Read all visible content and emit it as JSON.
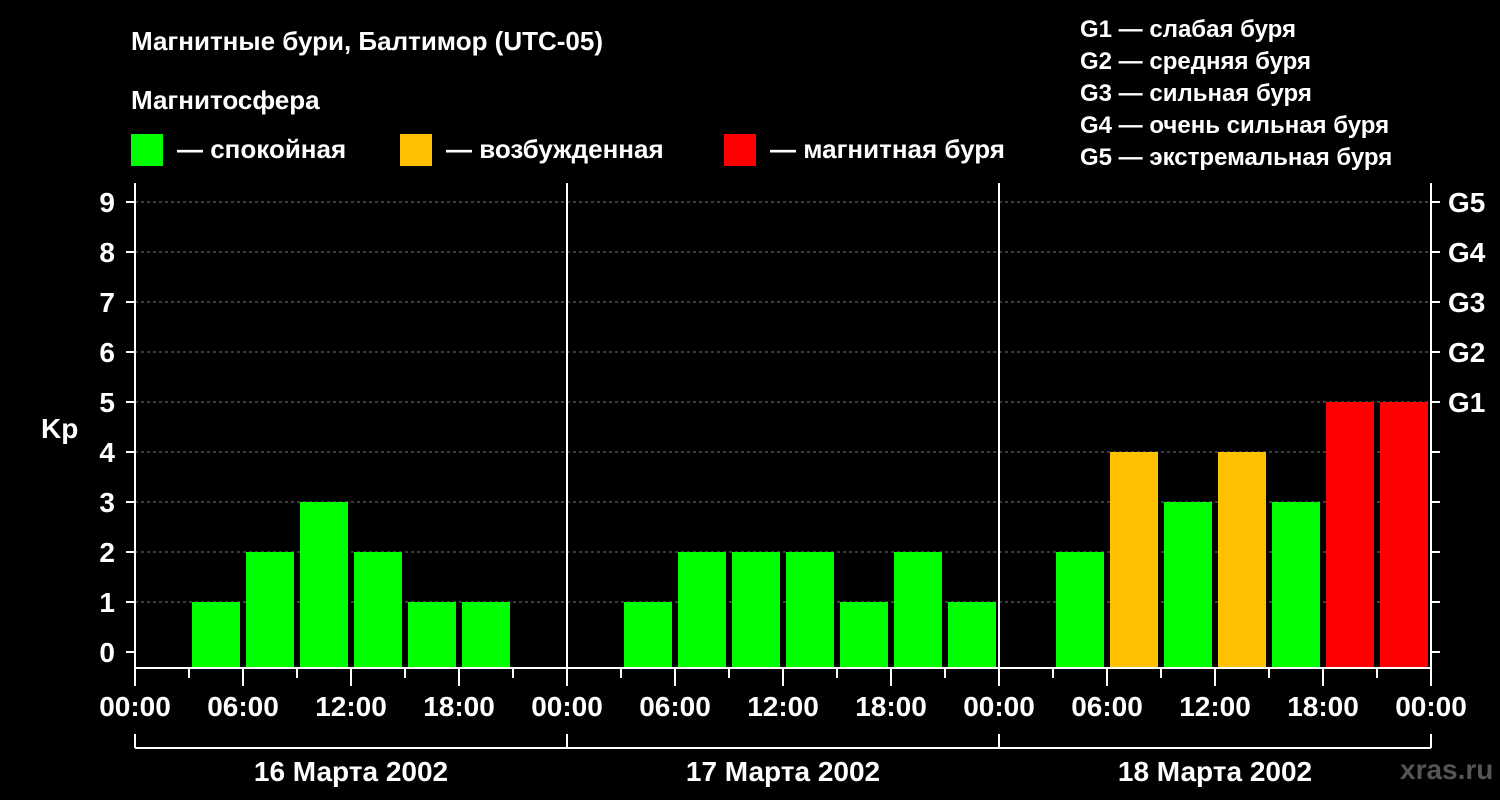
{
  "title": "Магнитные бури, Балтимор (UTC-05)",
  "legend": {
    "heading": "Магнитосфера",
    "items": [
      {
        "label": "— спокойная",
        "color": "#00ff00"
      },
      {
        "label": "— возбужденная",
        "color": "#ffc000"
      },
      {
        "label": "— магнитная буря",
        "color": "#ff0000"
      }
    ]
  },
  "g_scale": [
    "G1 — слабая буря",
    "G2 — средняя буря",
    "G3 — сильная буря",
    "G4 — очень сильная буря",
    "G5 — экстремальная буря"
  ],
  "watermark": "xras.ru",
  "chart_data": {
    "type": "bar",
    "ylabel": "Kp",
    "ylim": [
      0,
      9
    ],
    "yticks": [
      "0",
      "1",
      "2",
      "3",
      "4",
      "5",
      "6",
      "7",
      "8",
      "9"
    ],
    "right_ticks": [
      {
        "value": 5,
        "label": "G1"
      },
      {
        "value": 6,
        "label": "G2"
      },
      {
        "value": 7,
        "label": "G3"
      },
      {
        "value": 8,
        "label": "G4"
      },
      {
        "value": 9,
        "label": "G5"
      }
    ],
    "xtick_labels": [
      "00:00",
      "06:00",
      "12:00",
      "18:00",
      "00:00",
      "06:00",
      "12:00",
      "18:00",
      "00:00",
      "06:00",
      "12:00",
      "18:00",
      "00:00"
    ],
    "days": [
      "16 Марта 2002",
      "17 Марта 2002",
      "18 Марта 2002"
    ],
    "interval_hours": 3,
    "values": [
      [
        null,
        1,
        2,
        3,
        2,
        1,
        1,
        null
      ],
      [
        null,
        1,
        2,
        2,
        2,
        1,
        2,
        1
      ],
      [
        null,
        2,
        4,
        3,
        4,
        3,
        5,
        5
      ]
    ],
    "colors": {
      "quiet": "#00ff00",
      "active": "#ffc000",
      "storm": "#ff0000"
    },
    "grid": "dashed horizontal"
  }
}
